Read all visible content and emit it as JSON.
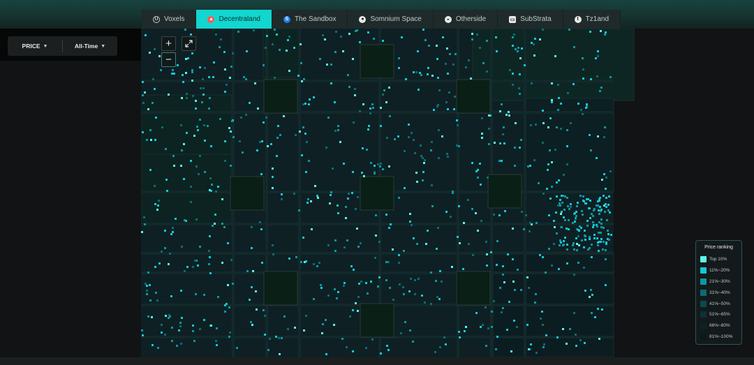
{
  "tabs": [
    {
      "label": "Voxels",
      "icon": "voxels-logo-icon",
      "active": false
    },
    {
      "label": "Decentraland",
      "icon": "decentraland-logo-icon",
      "active": true
    },
    {
      "label": "The Sandbox",
      "icon": "sandbox-logo-icon",
      "active": false
    },
    {
      "label": "Somnium Space",
      "icon": "somnium-logo-icon",
      "active": false
    },
    {
      "label": "Otherside",
      "icon": "otherside-logo-icon",
      "active": false
    },
    {
      "label": "SubStrata",
      "icon": "substrata-logo-icon",
      "active": false
    },
    {
      "label": "Tz1and",
      "icon": "tz1and-logo-icon",
      "active": false
    }
  ],
  "filters": {
    "metric_label": "PRICE",
    "period_label": "All-Time"
  },
  "map_controls": {
    "zoom_in": "+",
    "zoom_out": "−",
    "fullscreen_icon": "expand-icon"
  },
  "legend": {
    "title": "Price ranking",
    "items": [
      {
        "label": "Top 10%",
        "color": "#5ff5e6"
      },
      {
        "label": "11%~20%",
        "color": "#13c9d6"
      },
      {
        "label": "21%~30%",
        "color": "#0e97a0"
      },
      {
        "label": "31%~40%",
        "color": "#0c6c74"
      },
      {
        "label": "41%~50%",
        "color": "#0c4a50"
      },
      {
        "label": "51%~65%",
        "color": "#0d3034"
      },
      {
        "label": "66%~80%",
        "color": "#0b2226"
      },
      {
        "label": "81%~100%",
        "color": "#091a1d"
      }
    ]
  },
  "colors": {
    "accent": "#12d6cf",
    "parcel_base": "#0e2024",
    "plaza": "#0a1f16",
    "road": "#13292b"
  }
}
